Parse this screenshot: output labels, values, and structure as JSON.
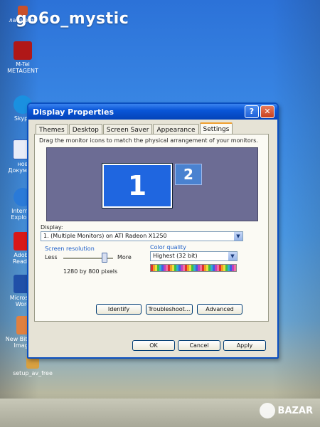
{
  "watermark": {
    "user": "go6o_mystic",
    "site": "BAZAR"
  },
  "desktop_icons": [
    {
      "label": "ла Firefox",
      "icon": "firefox-icon",
      "color": "#c8502a"
    },
    {
      "label": "M-Tel METAGENT",
      "icon": "mtel-icon",
      "color": "#b01818"
    },
    {
      "label": "Skype",
      "icon": "skype-icon",
      "color": "#1a90e0"
    },
    {
      "label": "нов Документ",
      "icon": "word-doc-icon",
      "color": "#2a5ab8"
    },
    {
      "label": "Internet Explorer",
      "icon": "ie-icon",
      "color": "#2a7ad8"
    },
    {
      "label": "Adobe Reader",
      "icon": "acrobat-icon",
      "color": "#d81818"
    },
    {
      "label": "Microsoft Word",
      "icon": "word-icon",
      "color": "#2050a8"
    },
    {
      "label": "New Bitmap Image",
      "icon": "bitmap-icon",
      "color": "#e08040"
    },
    {
      "label": "setup_av_free",
      "icon": "setup-icon",
      "color": "#d8a040"
    }
  ],
  "window": {
    "title": "Display Properties",
    "help_label": "?",
    "close_label": "✕",
    "tabs": [
      "Themes",
      "Desktop",
      "Screen Saver",
      "Appearance",
      "Settings"
    ],
    "active_tab": "Settings",
    "instruction": "Drag the monitor icons to match the physical arrangement of your monitors.",
    "monitor1_label": "1",
    "monitor2_label": "2",
    "display_label": "Display:",
    "display_value": "1. (Multiple Monitors) on ATI Radeon X1250",
    "resolution_label": "Screen resolution",
    "less_label": "Less",
    "more_label": "More",
    "resolution_value": "1280 by 800 pixels",
    "color_quality_label": "Color quality",
    "color_quality_value": "Highest (32 bit)",
    "identify_label": "Identify",
    "troubleshoot_label": "Troubleshoot...",
    "advanced_label": "Advanced",
    "ok_label": "OK",
    "cancel_label": "Cancel",
    "apply_label": "Apply"
  },
  "colors": {
    "title_bar": "#0a56d8",
    "monitor_selected": "#1f66e0",
    "monitor_area": "#6c6c94",
    "accent_tab": "#f0a030"
  }
}
